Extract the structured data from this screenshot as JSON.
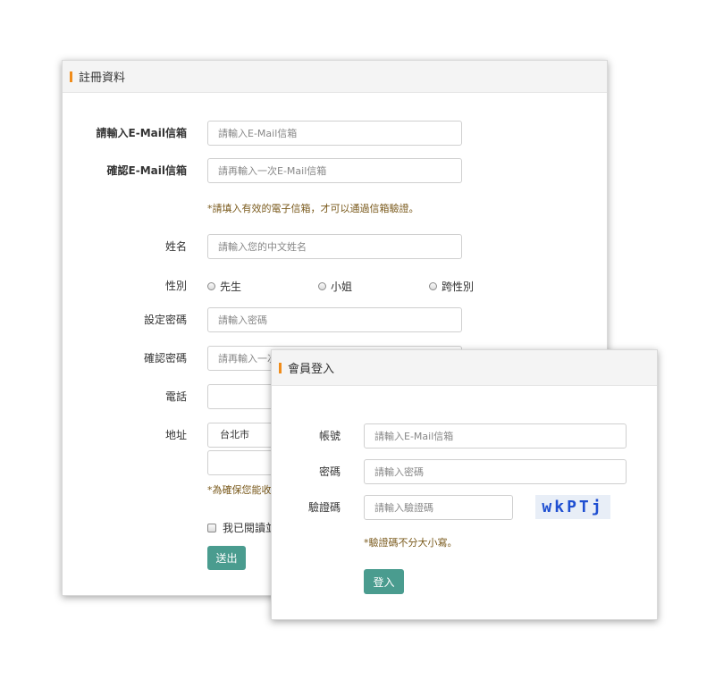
{
  "register": {
    "title": "註冊資料",
    "email_label": "請輸入E-Mail信箱",
    "email_placeholder": "請輸入E-Mail信箱",
    "confirm_email_label": "確認E-Mail信箱",
    "confirm_email_placeholder": "請再輸入一次E-Mail信箱",
    "email_hint": "*請填入有效的電子信箱，才可以通過信箱驗證。",
    "name_label": "姓名",
    "name_placeholder": "請輸入您的中文姓名",
    "gender_label": "性別",
    "gender_options": [
      "先生",
      "小姐",
      "跨性別"
    ],
    "password_label": "設定密碼",
    "password_placeholder": "請輸入密碼",
    "confirm_password_label": "確認密碼",
    "confirm_password_placeholder": "請再輸入一次",
    "phone_label": "電話",
    "address_label": "地址",
    "city_selected": "台北市",
    "address_hint": "*為確保您能收",
    "agree_label": "我已閱讀並",
    "submit_label": "送出"
  },
  "login": {
    "title": "會員登入",
    "account_label": "帳號",
    "account_placeholder": "請輸入E-Mail信箱",
    "password_label": "密碼",
    "password_placeholder": "請輸入密碼",
    "captcha_label": "驗證碼",
    "captcha_placeholder": "請輸入驗證碼",
    "captcha_text": "wkPTj",
    "captcha_hint": "*驗證碼不分大小寫。",
    "login_label": "登入"
  },
  "colors": {
    "accent_bar": "#f08c1a",
    "button": "#4a9c8f",
    "hint_text": "#7a5a1c",
    "captcha_text": "#1f4fd1"
  }
}
